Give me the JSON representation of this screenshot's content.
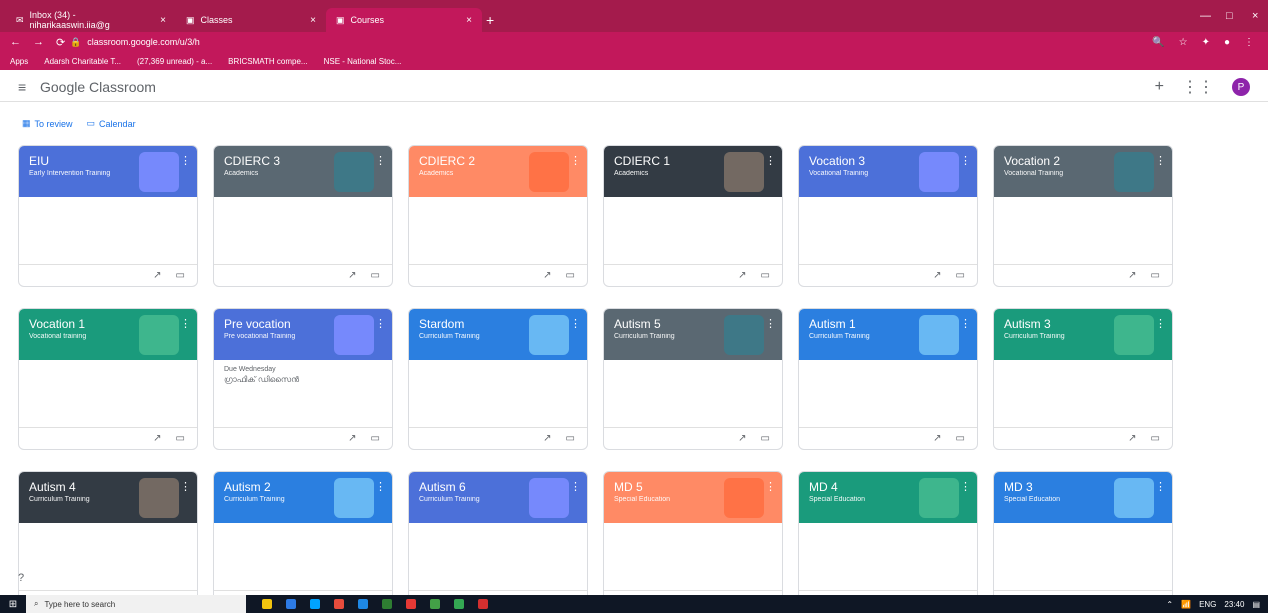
{
  "browser": {
    "tabs": [
      {
        "label": "Inbox (34) - niharikaaswin.iia@g",
        "active": false
      },
      {
        "label": "Classes",
        "active": false
      },
      {
        "label": "Courses",
        "active": true
      }
    ],
    "url": "classroom.google.com/u/3/h",
    "bookmarks": [
      "Apps",
      "Adarsh Charitable T...",
      "(27,369 unread) - a...",
      "BRICSMATH compe...",
      "NSE - National Stoc..."
    ]
  },
  "app": {
    "title_google": "Google",
    "title_classroom": "Classroom",
    "avatar_letter": "P"
  },
  "links": {
    "to_review": "To review",
    "calendar": "Calendar"
  },
  "cards": [
    {
      "title": "EIU",
      "subtitle": "Early Intervention Training",
      "color": "#4c70d9",
      "art": "#7b8cff",
      "row": 0,
      "col": 0
    },
    {
      "title": "CDIERC 3",
      "subtitle": "Academics",
      "color": "#5a6872",
      "art": "#3b7a8a",
      "row": 0,
      "col": 1
    },
    {
      "title": "CDIERC 2",
      "subtitle": "Academics",
      "color": "#ff8a65",
      "art": "#ff6f43",
      "row": 0,
      "col": 2
    },
    {
      "title": "CDIERC 1",
      "subtitle": "Academics",
      "color": "#333b44",
      "art": "#7a6f66",
      "row": 0,
      "col": 3
    },
    {
      "title": "Vocation 3",
      "subtitle": "Vocational Training",
      "color": "#4c70d9",
      "art": "#7b8cff",
      "row": 0,
      "col": 4
    },
    {
      "title": "Vocation 2",
      "subtitle": "Vocational Training",
      "color": "#5a6872",
      "art": "#3b7a8a",
      "row": 0,
      "col": 5
    },
    {
      "title": "Vocation 1",
      "subtitle": "Vocational training",
      "color": "#1a9b7c",
      "art": "#42b98f",
      "row": 1,
      "col": 0
    },
    {
      "title": "Pre vocation",
      "subtitle": "Pre vocational Training",
      "color": "#4c70d9",
      "art": "#7b8cff",
      "row": 1,
      "col": 1,
      "due": "Due Wednesday",
      "task": "ഗ്രാഫിക് ഡിസൈൻ"
    },
    {
      "title": "Stardom",
      "subtitle": "Curriculum Training",
      "color": "#2b7fe0",
      "art": "#6fbff5",
      "row": 1,
      "col": 2
    },
    {
      "title": "Autism 5",
      "subtitle": "Curriculum Training",
      "color": "#5a6872",
      "art": "#3b7a8a",
      "row": 1,
      "col": 3
    },
    {
      "title": "Autism 1",
      "subtitle": "Curriculum Training",
      "color": "#2b7fe0",
      "art": "#6fbff5",
      "row": 1,
      "col": 4
    },
    {
      "title": "Autism 3",
      "subtitle": "Curriculum Training",
      "color": "#1a9b7c",
      "art": "#42b98f",
      "row": 1,
      "col": 5
    },
    {
      "title": "Autism 4",
      "subtitle": "Curriculum Training",
      "color": "#333b44",
      "art": "#7a6f66",
      "row": 2,
      "col": 0
    },
    {
      "title": "Autism 2",
      "subtitle": "Curriculum Training",
      "color": "#2b7fe0",
      "art": "#6fbff5",
      "row": 2,
      "col": 1
    },
    {
      "title": "Autism 6",
      "subtitle": "Curriculum Training",
      "color": "#4c70d9",
      "art": "#7b8cff",
      "row": 2,
      "col": 2
    },
    {
      "title": "MD 5",
      "subtitle": "Special Education",
      "color": "#ff8a65",
      "art": "#ff6f43",
      "row": 2,
      "col": 3
    },
    {
      "title": "MD 4",
      "subtitle": "Special Education",
      "color": "#1a9b7c",
      "art": "#42b98f",
      "row": 2,
      "col": 4
    },
    {
      "title": "MD 3",
      "subtitle": "Special Education",
      "color": "#2b7fe0",
      "art": "#6fbff5",
      "row": 2,
      "col": 5
    }
  ],
  "taskbar": {
    "search_placeholder": "Type here to search",
    "time": "23:40",
    "lang": "ENG",
    "icon_colors": [
      "#f1c40f",
      "#2d7be5",
      "#00a3ff",
      "#e74c3c",
      "#1e88e5",
      "#2e7d32",
      "#e53935",
      "#43a047",
      "#34a853",
      "#d32f2f"
    ]
  },
  "help_icon": "?"
}
